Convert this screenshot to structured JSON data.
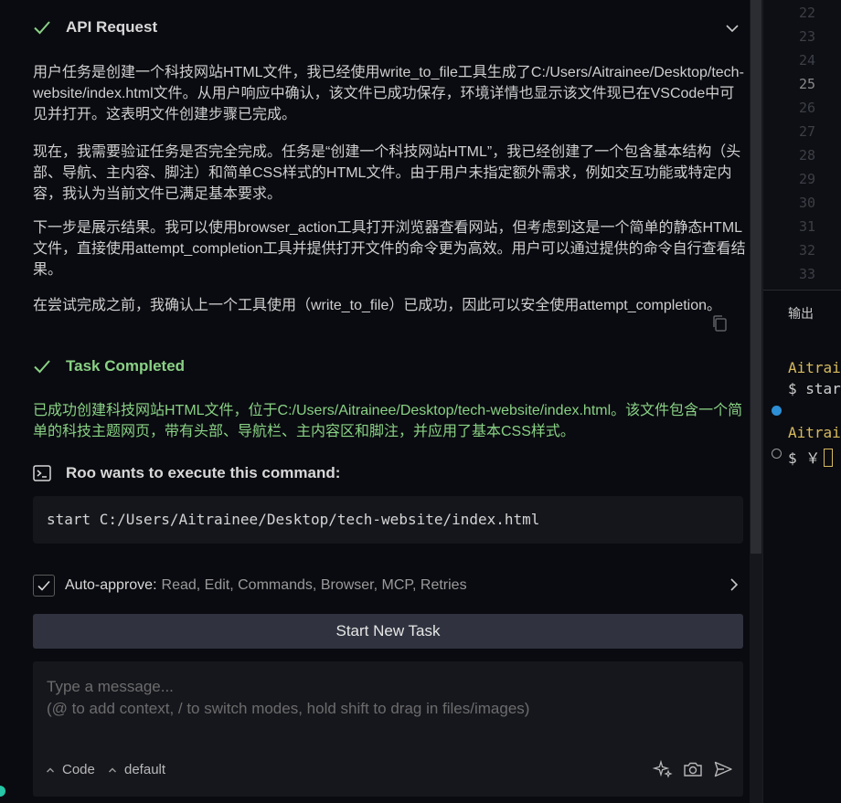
{
  "api_request": {
    "title": "API Request",
    "paragraphs": [
      "用户任务是创建一个科技网站HTML文件，我已经使用write_to_file工具生成了C:/Users/Aitrainee/Desktop/tech-website/index.html文件。从用户响应中确认，该文件已成功保存，环境详情也显示该文件现已在VSCode中可见并打开。这表明文件创建步骤已完成。",
      "现在，我需要验证任务是否完全完成。任务是“创建一个科技网站HTML”，我已经创建了一个包含基本结构（头部、导航、主内容、脚注）和简单CSS样式的HTML文件。由于用户未指定额外需求，例如交互功能或特定内容，我认为当前文件已满足基本要求。",
      "下一步是展示结果。我可以使用browser_action工具打开浏览器查看网站，但考虑到这是一个简单的静态HTML文件，直接使用attempt_completion工具并提供打开文件的命令更为高效。用户可以通过提供的命令自行查看结果。",
      "在尝试完成之前，我确认上一个工具使用（write_to_file）已成功，因此可以安全使用attempt_completion。"
    ]
  },
  "task_completed": {
    "title": "Task Completed",
    "text": "已成功创建科技网站HTML文件，位于C:/Users/Aitrainee/Desktop/tech-website/index.html。该文件包含一个简单的科技主题网页，带有头部、导航栏、主内容区和脚注，并应用了基本CSS样式。"
  },
  "command": {
    "title": "Roo wants to execute this command:",
    "text": "start C:/Users/Aitrainee/Desktop/tech-website/index.html"
  },
  "auto_approve": {
    "label": "Auto-approve:",
    "items": "Read, Edit, Commands, Browser, MCP, Retries",
    "checked": true
  },
  "start_new_task_label": "Start New Task",
  "composer": {
    "placeholder_line1": "Type a message...",
    "placeholder_line2": "(@ to add context, / to switch modes, hold shift to drag in files/images)",
    "mode": "Code",
    "config": "default"
  },
  "editor": {
    "line_numbers": [
      "22",
      "23",
      "24",
      "25",
      "26",
      "27",
      "28",
      "29",
      "30",
      "31",
      "32",
      "33"
    ],
    "active_line": "25"
  },
  "terminal": {
    "tab_label": "输出",
    "line1": "Aitrai",
    "line2": "$ star",
    "line3": "Aitrai",
    "line4": "$ ￥"
  },
  "colors": {
    "success": "#89d185",
    "background": "#0a0b10",
    "button": "#30333f",
    "terminal_user": "#d7ba5f"
  }
}
